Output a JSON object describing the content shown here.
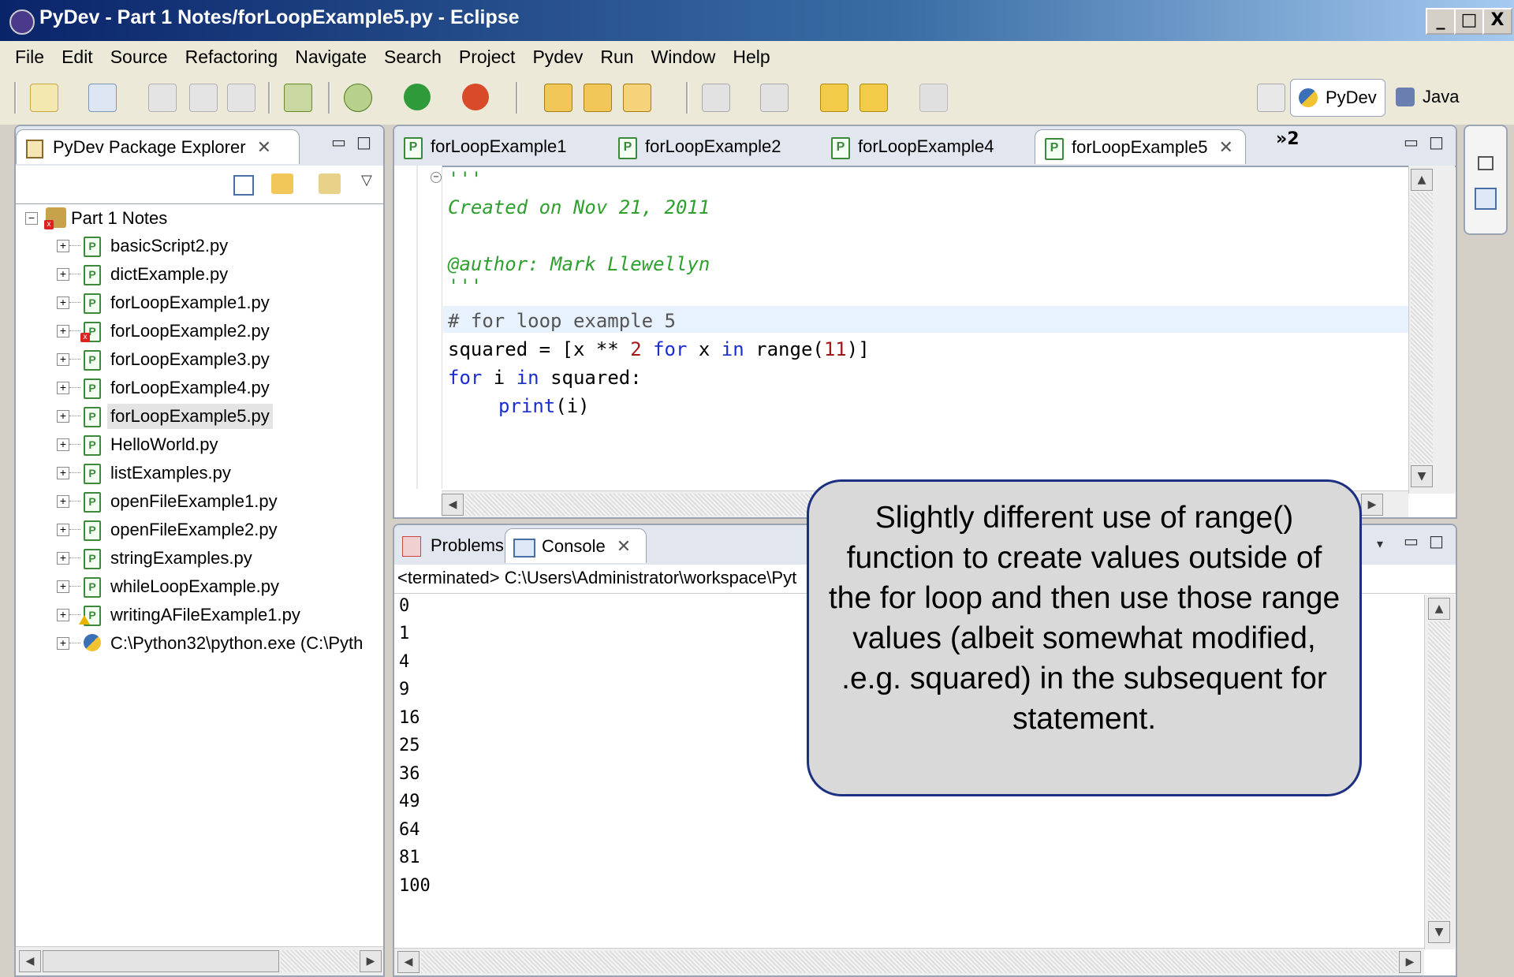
{
  "window": {
    "title": "PyDev - Part 1 Notes/forLoopExample5.py - Eclipse",
    "minimize": "_",
    "maximize": "□",
    "close": "X"
  },
  "menu": [
    "File",
    "Edit",
    "Source",
    "Refactoring",
    "Navigate",
    "Search",
    "Project",
    "Pydev",
    "Run",
    "Window",
    "Help"
  ],
  "perspectives": {
    "pydev": "PyDev",
    "java": "Java"
  },
  "explorer": {
    "title": "PyDev Package Explorer",
    "project": "Part 1 Notes",
    "files": [
      "basicScript2.py",
      "dictExample.py",
      "forLoopExample1.py",
      "forLoopExample2.py",
      "forLoopExample3.py",
      "forLoopExample4.py",
      "forLoopExample5.py",
      "HelloWorld.py",
      "listExamples.py",
      "openFileExample1.py",
      "openFileExample2.py",
      "stringExamples.py",
      "whileLoopExample.py",
      "writingAFileExample1.py",
      "C:\\Python32\\python.exe  (C:\\Pyth"
    ],
    "selected": "forLoopExample5.py"
  },
  "editor": {
    "tabs": [
      "forLoopExample1",
      "forLoopExample2",
      "forLoopExample4",
      "forLoopExample5"
    ],
    "overflow": "»2",
    "active_tab": "forLoopExample5",
    "code": {
      "l1": "'''",
      "l2": "Created on Nov 21, 2011",
      "l3": "@author: Mark Llewellyn",
      "l4": "'''",
      "l5": "# for loop example 5",
      "l6a": "squared = [x ** ",
      "l6b": "2",
      "l6c": " for",
      "l6d": " x ",
      "l6e": "in",
      "l6f": " range(",
      "l6g": "11",
      "l6h": ")]",
      "l7a": "for",
      "l7b": " i ",
      "l7c": "in",
      "l7d": " squared:",
      "l8a": "print",
      "l8b": "(i)"
    }
  },
  "console": {
    "tabs": {
      "problems": "Problems",
      "console": "Console"
    },
    "status": "<terminated> C:\\Users\\Administrator\\workspace\\Pyt",
    "output": [
      "0",
      "1",
      "4",
      "9",
      "16",
      "25",
      "36",
      "49",
      "64",
      "81",
      "100"
    ]
  },
  "callout": {
    "text": "Slightly different use of range() function to create values outside of the for loop and then use those range values (albeit somewhat modified, .e.g. squared) in the subsequent for statement."
  }
}
